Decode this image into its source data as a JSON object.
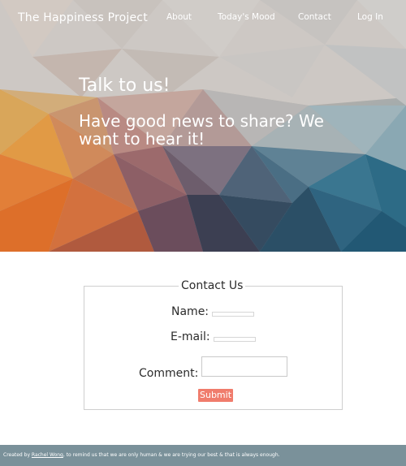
{
  "nav": {
    "brand": "The Happiness Project",
    "links": [
      "About",
      "Today's Mood",
      "Contact",
      "Log In"
    ]
  },
  "hero": {
    "title": "Talk to us!",
    "subtitle": "Have good news to share? We want to hear it!"
  },
  "contact": {
    "legend": "Contact Us",
    "name_label": "Name:",
    "email_label": "E-mail:",
    "comment_label": "Comment:",
    "name_value": "",
    "email_value": "",
    "comment_value": "",
    "submit_label": "Submit"
  },
  "footer": {
    "prefix": "Created by ",
    "author": "Rachel Wong",
    "suffix": ", to remind us that we are only human & we are trying our best & that is always enough."
  },
  "colors": {
    "submit": "#f07c6c",
    "footer": "#7a919a",
    "hero_orange": "#e0783a",
    "hero_teal": "#2f6b83"
  }
}
